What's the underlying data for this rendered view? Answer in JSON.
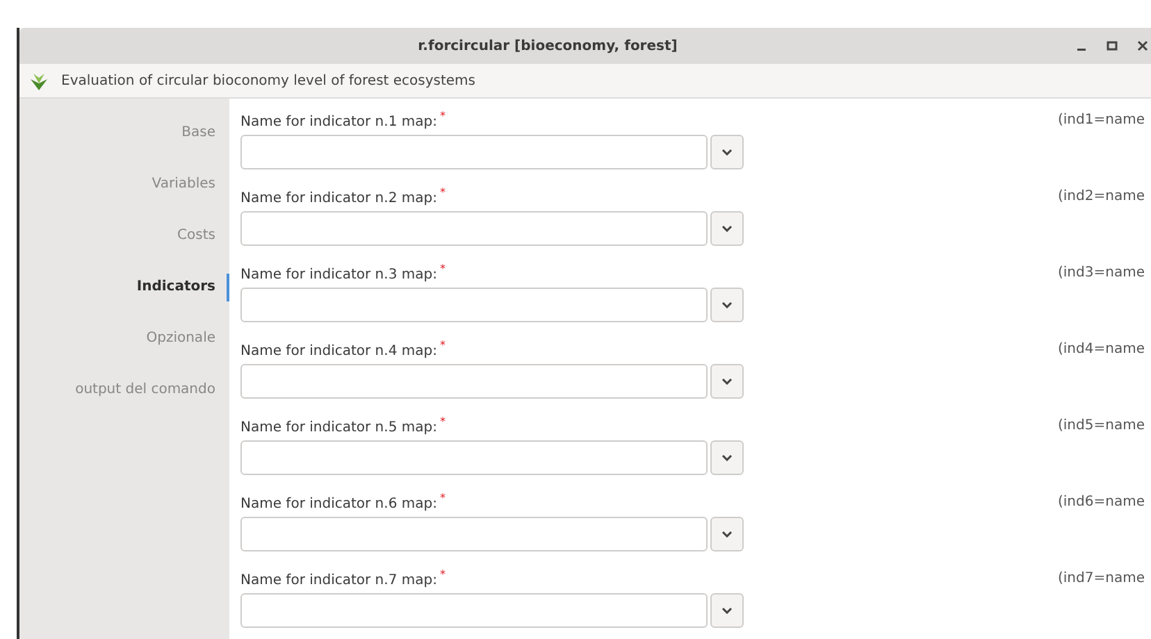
{
  "window": {
    "title": "r.forcircular [bioeconomy, forest]"
  },
  "header": {
    "description": "Evaluation of circular bioconomy level of forest ecosystems"
  },
  "sidebar": {
    "items": [
      {
        "label": "Base",
        "selected": false
      },
      {
        "label": "Variables",
        "selected": false
      },
      {
        "label": "Costs",
        "selected": false
      },
      {
        "label": "Indicators",
        "selected": true
      },
      {
        "label": "Opzionale",
        "selected": false
      },
      {
        "label": "output del comando",
        "selected": false
      }
    ]
  },
  "fields": [
    {
      "label": "Name for indicator n.1 map:",
      "marker": "*",
      "hint": "(ind1=name"
    },
    {
      "label": "Name for indicator n.2 map:",
      "marker": "*",
      "hint": "(ind2=name"
    },
    {
      "label": "Name for indicator n.3 map:",
      "marker": "*",
      "hint": "(ind3=name"
    },
    {
      "label": "Name for indicator n.4 map:",
      "marker": "*",
      "hint": "(ind4=name"
    },
    {
      "label": "Name for indicator n.5 map:",
      "marker": "*",
      "hint": "(ind5=name"
    },
    {
      "label": "Name for indicator n.6 map:",
      "marker": "*",
      "hint": "(ind6=name"
    },
    {
      "label": "Name for indicator n.7 map:",
      "marker": "*",
      "hint": "(ind7=name"
    }
  ]
}
